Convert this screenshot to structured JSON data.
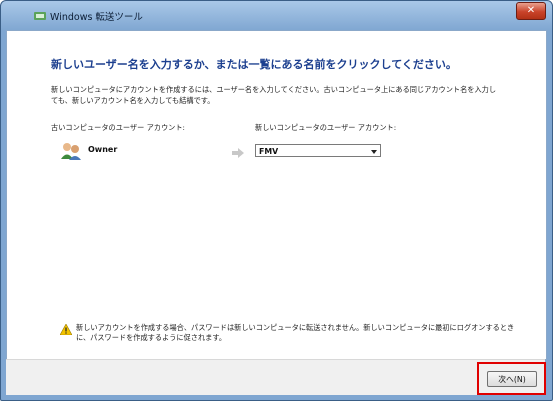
{
  "window": {
    "title": "Windows 転送ツール",
    "close_label": "✕"
  },
  "main": {
    "heading": "新しいユーザー名を入力するか、または一覧にある名前をクリックしてください。",
    "description": "新しいコンピュータにアカウントを作成するには、ユーザー名を入力してください。古いコンピュータ上にある同じアカウント名を入力しても、新しいアカウント名を入力しても結構です。",
    "old_account_label": "古いコンピュータのユーザー アカウント:",
    "new_account_label": "新しいコンピュータのユーザー アカウント:",
    "old_user": "Owner",
    "new_user_selected": "FMV",
    "warning": "新しいアカウントを作成する場合、パスワードは新しいコンピュータに転送されません。新しいコンピュータに最初にログオンするときに、パスワードを作成するように促されます。"
  },
  "footer": {
    "next_label": "次へ(N)"
  },
  "icons": {
    "app": "transfer-app-icon",
    "user": "users-icon",
    "arrow": "right-arrow-icon",
    "warning": "warning-icon",
    "caret": "chevron-down-icon"
  },
  "colors": {
    "heading": "#1c3f8f",
    "highlight": "#e00000",
    "titlebar": "#7fa6d1"
  }
}
